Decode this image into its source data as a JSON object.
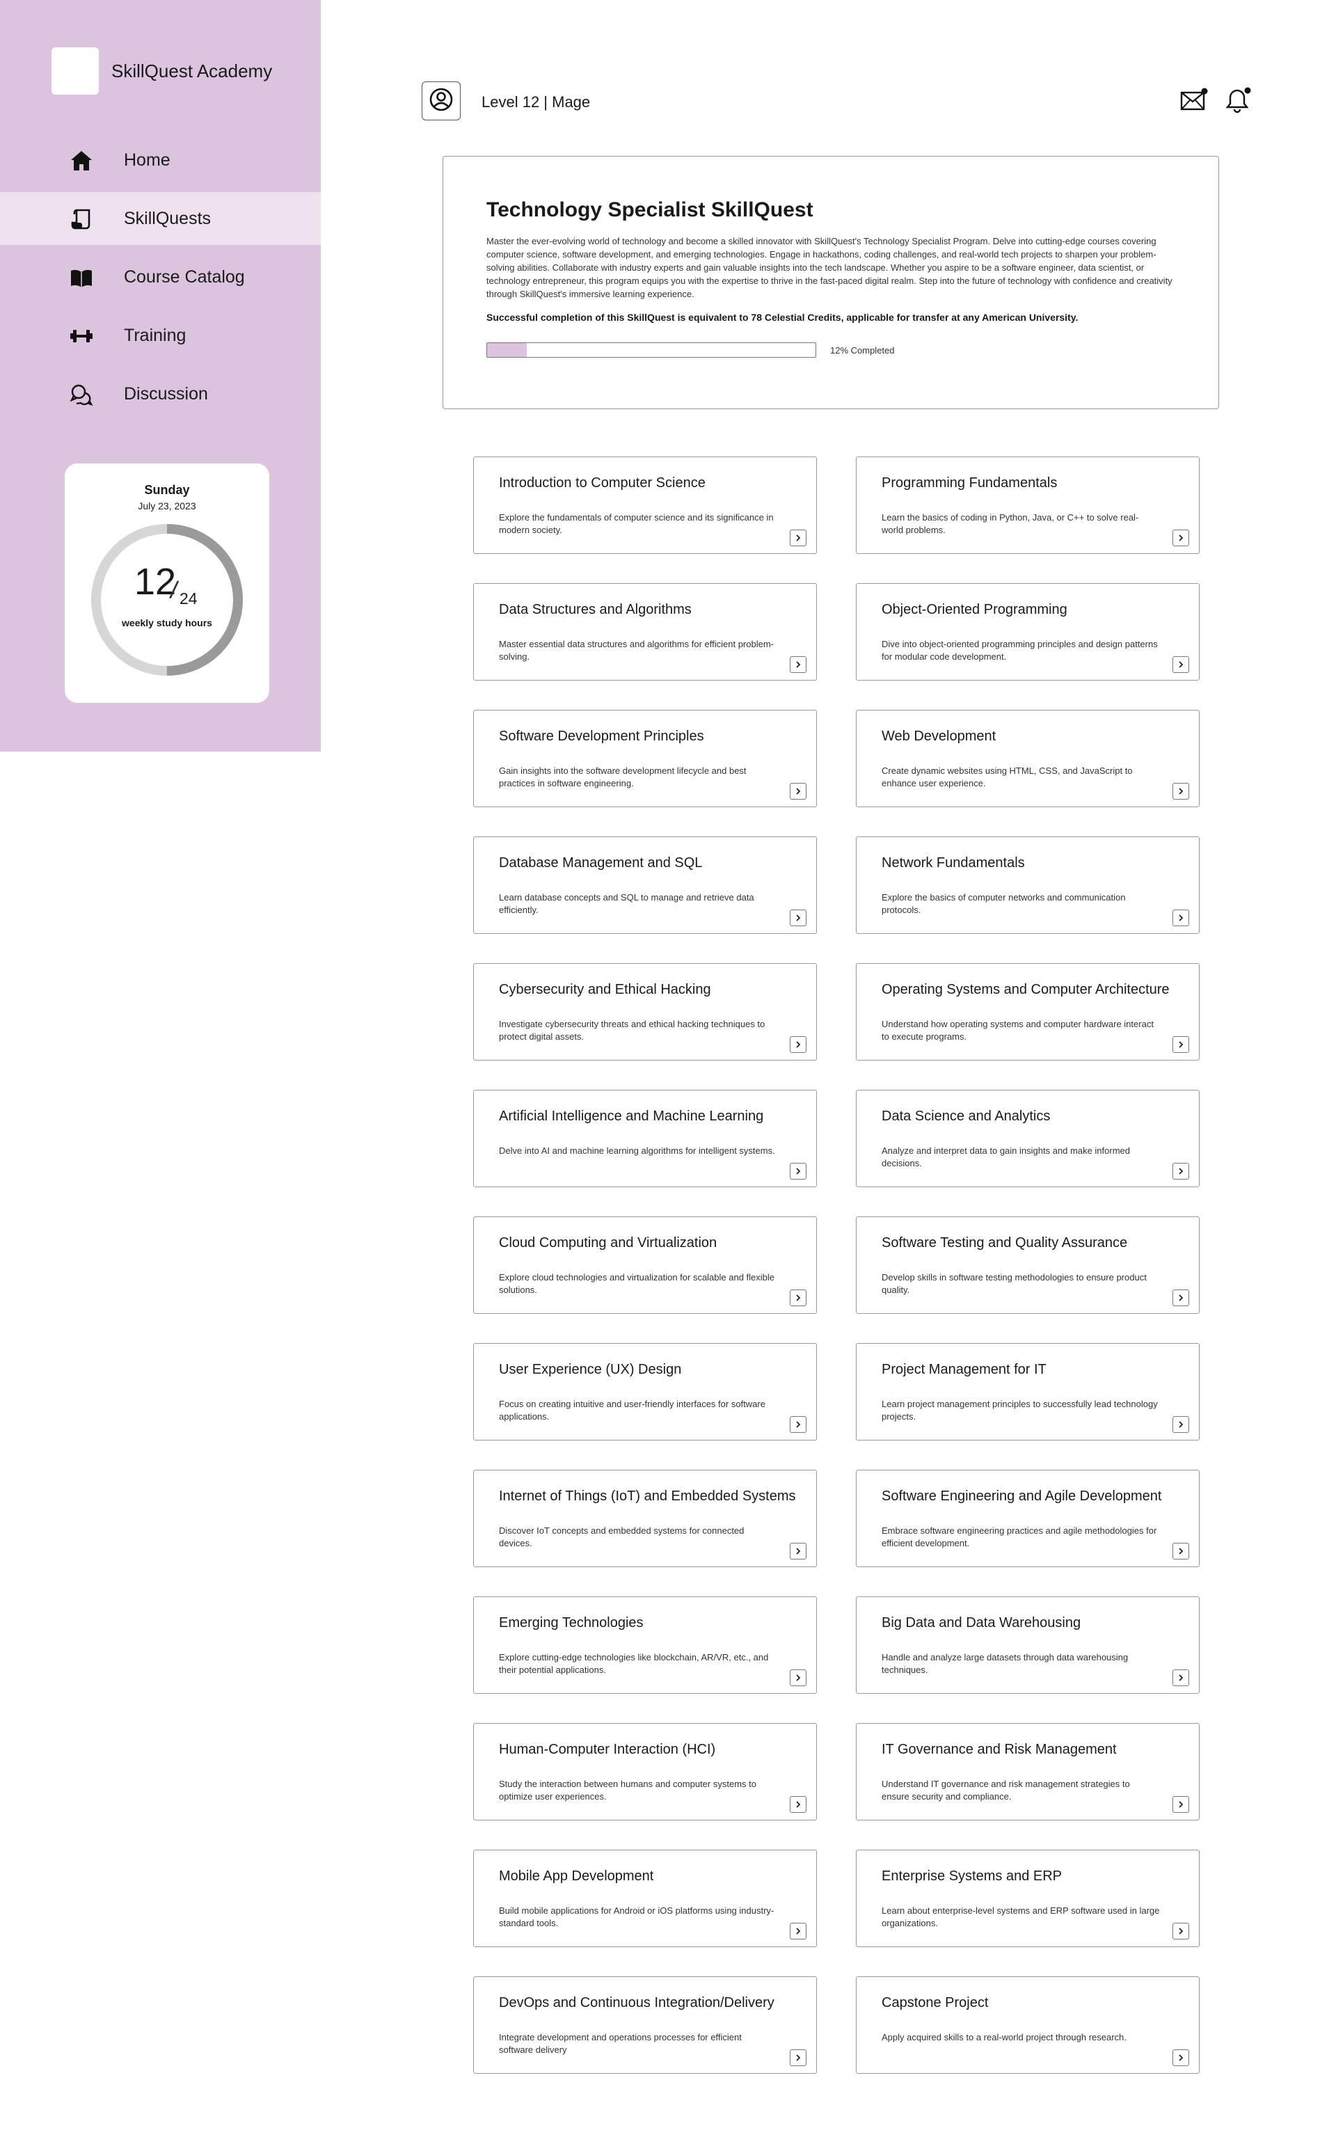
{
  "brand": {
    "name": "SkillQuest Academy"
  },
  "nav": [
    {
      "label": "Home",
      "icon": "home-icon"
    },
    {
      "label": "SkillQuests",
      "icon": "scroll-icon",
      "active": true
    },
    {
      "label": "Course Catalog",
      "icon": "book-icon"
    },
    {
      "label": "Training",
      "icon": "dumbbell-icon"
    },
    {
      "label": "Discussion",
      "icon": "chat-icon"
    }
  ],
  "study": {
    "day": "Sunday",
    "date": "July 23, 2023",
    "hours": "12",
    "goal": "24",
    "caption": "weekly study hours",
    "fraction": 0.5
  },
  "header": {
    "level": "Level 12 | Mage"
  },
  "overview": {
    "title": "Technology Specialist SkillQuest",
    "description": "Master the ever-evolving world of technology and become a skilled innovator with SkillQuest's Technology Specialist Program. Delve into cutting-edge courses covering computer science, software development, and emerging technologies. Engage in hackathons, coding challenges, and real-world tech projects to sharpen your problem-solving abilities. Collaborate with industry experts and gain valuable insights into the tech landscape. Whether you aspire to be a software engineer, data scientist, or technology entrepreneur, this program equips you with the expertise to thrive in the fast-paced digital realm. Step into the future of technology with confidence and creativity through SkillQuest's immersive learning experience.",
    "credit": "Successful completion of this SkillQuest is equivalent to 78 Celestial Credits, applicable for transfer at any American University.",
    "progress": 0.12,
    "progress_label": "12% Completed"
  },
  "colors": {
    "sidebar": "#dcc4de",
    "active_nav": "#eee2ef",
    "ring_track": "#d6d6d6",
    "ring_fill": "#9a9a9a"
  },
  "courses": [
    {
      "title": "Introduction to Computer Science",
      "desc": "Explore the fundamentals of computer science and its significance in modern society."
    },
    {
      "title": "Programming Fundamentals",
      "desc": "Learn the basics of coding in Python, Java, or C++ to solve real-world problems."
    },
    {
      "title": "Data Structures and Algorithms",
      "desc": "Master essential data structures and algorithms for efficient problem-solving."
    },
    {
      "title": "Object-Oriented Programming",
      "desc": "Dive into object-oriented programming principles and design patterns for modular code development."
    },
    {
      "title": "Software Development Principles",
      "desc": "Gain insights into the software development lifecycle and best practices in software engineering."
    },
    {
      "title": "Web Development",
      "desc": "Create dynamic websites using HTML, CSS, and JavaScript to enhance user experience."
    },
    {
      "title": "Database Management and SQL",
      "desc": "Learn database concepts and SQL to manage and retrieve data efficiently."
    },
    {
      "title": "Network Fundamentals",
      "desc": "Explore the basics of computer networks and communication protocols."
    },
    {
      "title": "Cybersecurity and Ethical Hacking",
      "desc": "Investigate cybersecurity threats and ethical hacking techniques to protect digital assets."
    },
    {
      "title": "Operating Systems and Computer Architecture",
      "desc": "Understand how operating systems and computer hardware interact to execute programs."
    },
    {
      "title": "Artificial Intelligence and Machine Learning",
      "desc": "Delve into AI and machine learning algorithms for intelligent systems."
    },
    {
      "title": "Data Science and Analytics",
      "desc": "Analyze and interpret data to gain insights and make informed decisions."
    },
    {
      "title": "Cloud Computing and Virtualization",
      "desc": "Explore cloud technologies and virtualization for scalable and flexible solutions."
    },
    {
      "title": "Software Testing and Quality Assurance",
      "desc": "Develop skills in software testing methodologies to ensure product quality."
    },
    {
      "title": "User Experience (UX) Design",
      "desc": "Focus on creating intuitive and user-friendly interfaces for software applications."
    },
    {
      "title": "Project Management for IT",
      "desc": "Learn project management principles to successfully lead technology projects."
    },
    {
      "title": "Internet of Things (IoT) and Embedded Systems",
      "desc": "Discover IoT concepts and embedded systems for connected devices."
    },
    {
      "title": "Software Engineering and Agile Development",
      "desc": "Embrace software engineering practices and agile methodologies for efficient development."
    },
    {
      "title": "Emerging Technologies",
      "desc": "Explore cutting-edge technologies like blockchain, AR/VR, etc., and their potential applications."
    },
    {
      "title": "Big Data and Data Warehousing",
      "desc": "Handle and analyze large datasets through data warehousing techniques."
    },
    {
      "title": "Human-Computer Interaction (HCI)",
      "desc": "Study the interaction between humans and computer systems to optimize user experiences."
    },
    {
      "title": "IT Governance and Risk Management",
      "desc": "Understand IT governance and risk management strategies to ensure security and compliance."
    },
    {
      "title": "Mobile App Development",
      "desc": "Build mobile applications for Android or iOS platforms using industry-standard tools."
    },
    {
      "title": "Enterprise Systems and ERP",
      "desc": "Learn about enterprise-level systems and ERP software used in large organizations."
    },
    {
      "title": "DevOps and Continuous Integration/Delivery",
      "desc": "Integrate development and operations processes for efficient software delivery"
    },
    {
      "title": "Capstone Project",
      "desc": "Apply acquired skills to a real-world project through research."
    }
  ]
}
